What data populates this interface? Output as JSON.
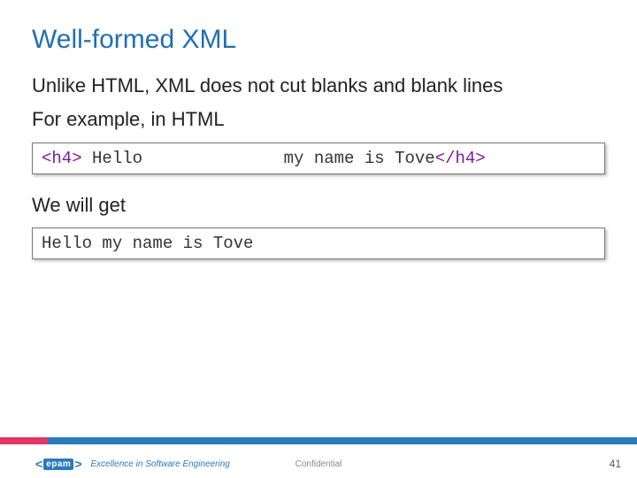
{
  "title": "Well-formed XML",
  "para1": "Unlike HTML, XML does not cut blanks and blank lines",
  "para2": "For example, in HTML",
  "code1": {
    "open": "<h4>",
    "text": " Hello              my name is Tove",
    "close": "</h4>"
  },
  "para3": "We will get",
  "code2": "Hello my name is Tove",
  "footer": {
    "logo_name": "epam",
    "tagline": "Excellence in Software Engineering",
    "confidential": "Confidential",
    "page": "41"
  }
}
